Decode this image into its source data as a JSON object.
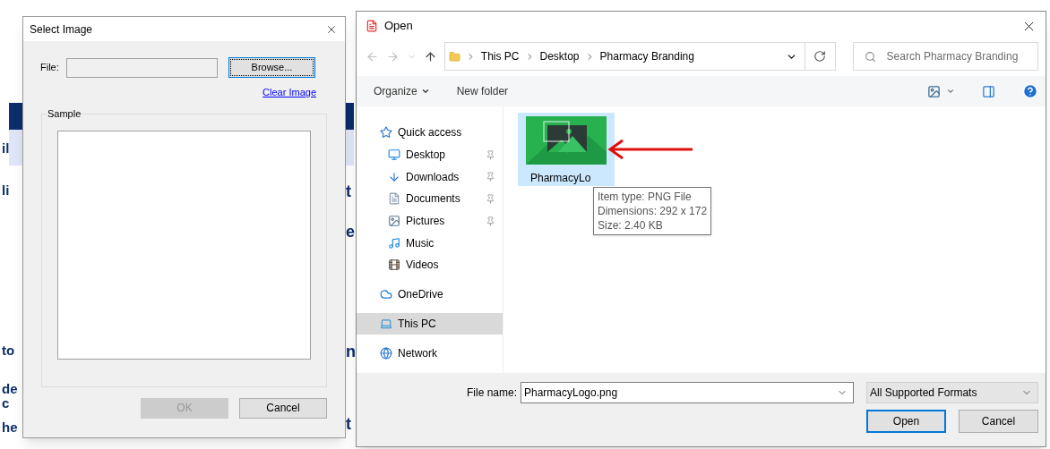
{
  "background": {
    "fragments_left": [
      "il",
      "li",
      "to",
      "de",
      "c",
      "he"
    ],
    "fragments_right": [
      "t",
      "e",
      "n",
      "t"
    ]
  },
  "select_image": {
    "title": "Select Image",
    "file_label": "File:",
    "browse": "Browse...",
    "clear": "Clear Image",
    "sample": "Sample",
    "ok": {
      "label": "OK",
      "disabled": true
    },
    "cancel": {
      "label": "Cancel",
      "disabled": false
    }
  },
  "open_dialog": {
    "title": "Open",
    "breadcrumb": [
      "This PC",
      "Desktop",
      "Pharmacy Branding"
    ],
    "search": {
      "placeholder": "Search Pharmacy Branding"
    },
    "toolbar": [
      "Organize",
      "New folder"
    ],
    "nav": [
      {
        "kind": "star",
        "label": "Quick access",
        "pinned": false,
        "selected": false,
        "group": true
      },
      {
        "kind": "desktop",
        "label": "Desktop",
        "pinned": true,
        "selected": false,
        "group": false
      },
      {
        "kind": "download",
        "label": "Downloads",
        "pinned": true,
        "selected": false,
        "group": false
      },
      {
        "kind": "document",
        "label": "Documents",
        "pinned": true,
        "selected": false,
        "group": false
      },
      {
        "kind": "pictures",
        "label": "Pictures",
        "pinned": true,
        "selected": false,
        "group": false
      },
      {
        "kind": "music",
        "label": "Music",
        "pinned": false,
        "selected": false,
        "group": false
      },
      {
        "kind": "video",
        "label": "Videos",
        "pinned": false,
        "selected": false,
        "group": false
      },
      {
        "kind": "cloud",
        "label": "OneDrive",
        "pinned": false,
        "selected": false,
        "group": true
      },
      {
        "kind": "pc",
        "label": "This PC",
        "pinned": false,
        "selected": true,
        "group": true
      },
      {
        "kind": "network",
        "label": "Network",
        "pinned": false,
        "selected": false,
        "group": true
      }
    ],
    "file": {
      "label": "PharmacyLo",
      "selected": true
    },
    "tooltip": [
      "Item type: PNG File",
      "Dimensions: 292 x 172",
      "Size: 2.40 KB"
    ],
    "file_name_label": "File name:",
    "file_name": "PharmacyLogo.png",
    "filter": "All Supported Formats",
    "open": "Open",
    "cancel": "Cancel"
  }
}
